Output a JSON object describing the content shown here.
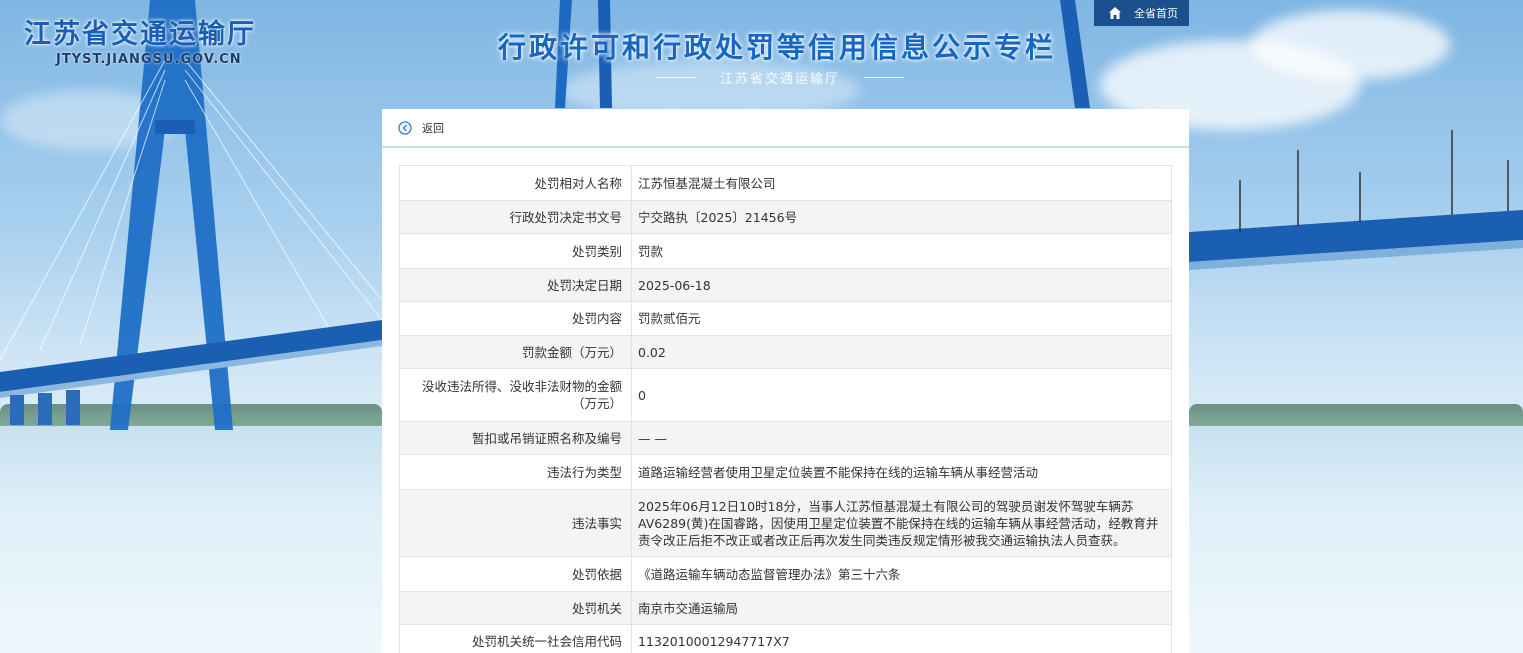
{
  "header": {
    "site_title": "江苏省交通运输厅",
    "site_domain": "JTYST.JIANGSU.GOV.CN",
    "banner_title": "行政许可和行政处罚等信用信息公示专栏",
    "banner_subtitle": "江苏省交通运输厅",
    "home_link": "全省首页"
  },
  "panel": {
    "back_label": "返回",
    "rows": [
      {
        "label": "处罚相对人名称",
        "value": "江苏恒基混凝土有限公司"
      },
      {
        "label": "行政处罚决定书文号",
        "value": "宁交路执〔2025〕21456号"
      },
      {
        "label": "处罚类别",
        "value": "罚款"
      },
      {
        "label": "处罚决定日期",
        "value": "2025-06-18"
      },
      {
        "label": "处罚内容",
        "value": "罚款贰佰元"
      },
      {
        "label": "罚款金额（万元）",
        "value": "0.02"
      },
      {
        "label": "没收违法所得、没收非法财物的金额（万元）",
        "value": "0"
      },
      {
        "label": "暂扣或吊销证照名称及编号",
        "value": "— —"
      },
      {
        "label": "违法行为类型",
        "value": "道路运输经营者使用卫星定位装置不能保持在线的运输车辆从事经营活动"
      },
      {
        "label": "违法事实",
        "value": "2025年06月12日10时18分，当事人江苏恒基混凝土有限公司的驾驶员谢发怀驾驶车辆苏AV6289(黄)在国睿路，因使用卫星定位装置不能保持在线的运输车辆从事经营活动，经教育并责令改正后拒不改正或者改正后再次发生同类违反规定情形被我交通运输执法人员查获。"
      },
      {
        "label": "处罚依据",
        "value": "《道路运输车辆动态监督管理办法》第三十六条"
      },
      {
        "label": "处罚机关",
        "value": "南京市交通运输局"
      },
      {
        "label": "处罚机关统一社会信用代码",
        "value": "11320100012947717X7"
      }
    ]
  }
}
